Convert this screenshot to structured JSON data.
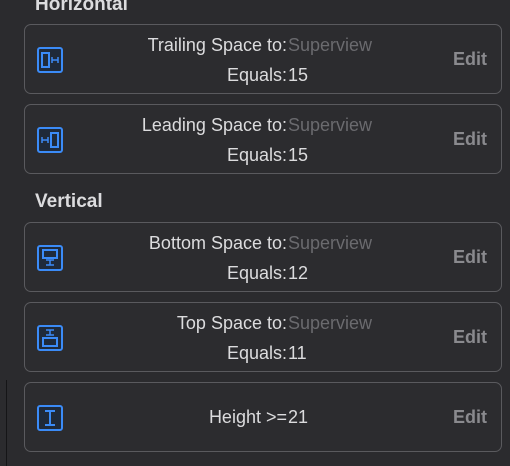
{
  "sections": {
    "horizontal": "Horizontal",
    "vertical": "Vertical"
  },
  "constraints": [
    {
      "icon": "trailing-space-icon",
      "label": "Trailing Space to:",
      "target": "Superview",
      "equals_label": "Equals:",
      "value": "15",
      "edit": "Edit"
    },
    {
      "icon": "leading-space-icon",
      "label": "Leading Space to:",
      "target": "Superview",
      "equals_label": "Equals:",
      "value": "15",
      "edit": "Edit"
    },
    {
      "icon": "bottom-space-icon",
      "label": "Bottom Space to:",
      "target": "Superview",
      "equals_label": "Equals:",
      "value": "12",
      "edit": "Edit"
    },
    {
      "icon": "top-space-icon",
      "label": "Top Space to:",
      "target": "Superview",
      "equals_label": "Equals:",
      "value": "11",
      "edit": "Edit"
    },
    {
      "icon": "height-icon",
      "label": "Height >=",
      "value": "21",
      "edit": "Edit"
    }
  ],
  "colors": {
    "accent": "#3b8bf7",
    "background": "#2b2b2e",
    "border": "#5a5a5e",
    "muted_text": "#6a6a6e"
  }
}
